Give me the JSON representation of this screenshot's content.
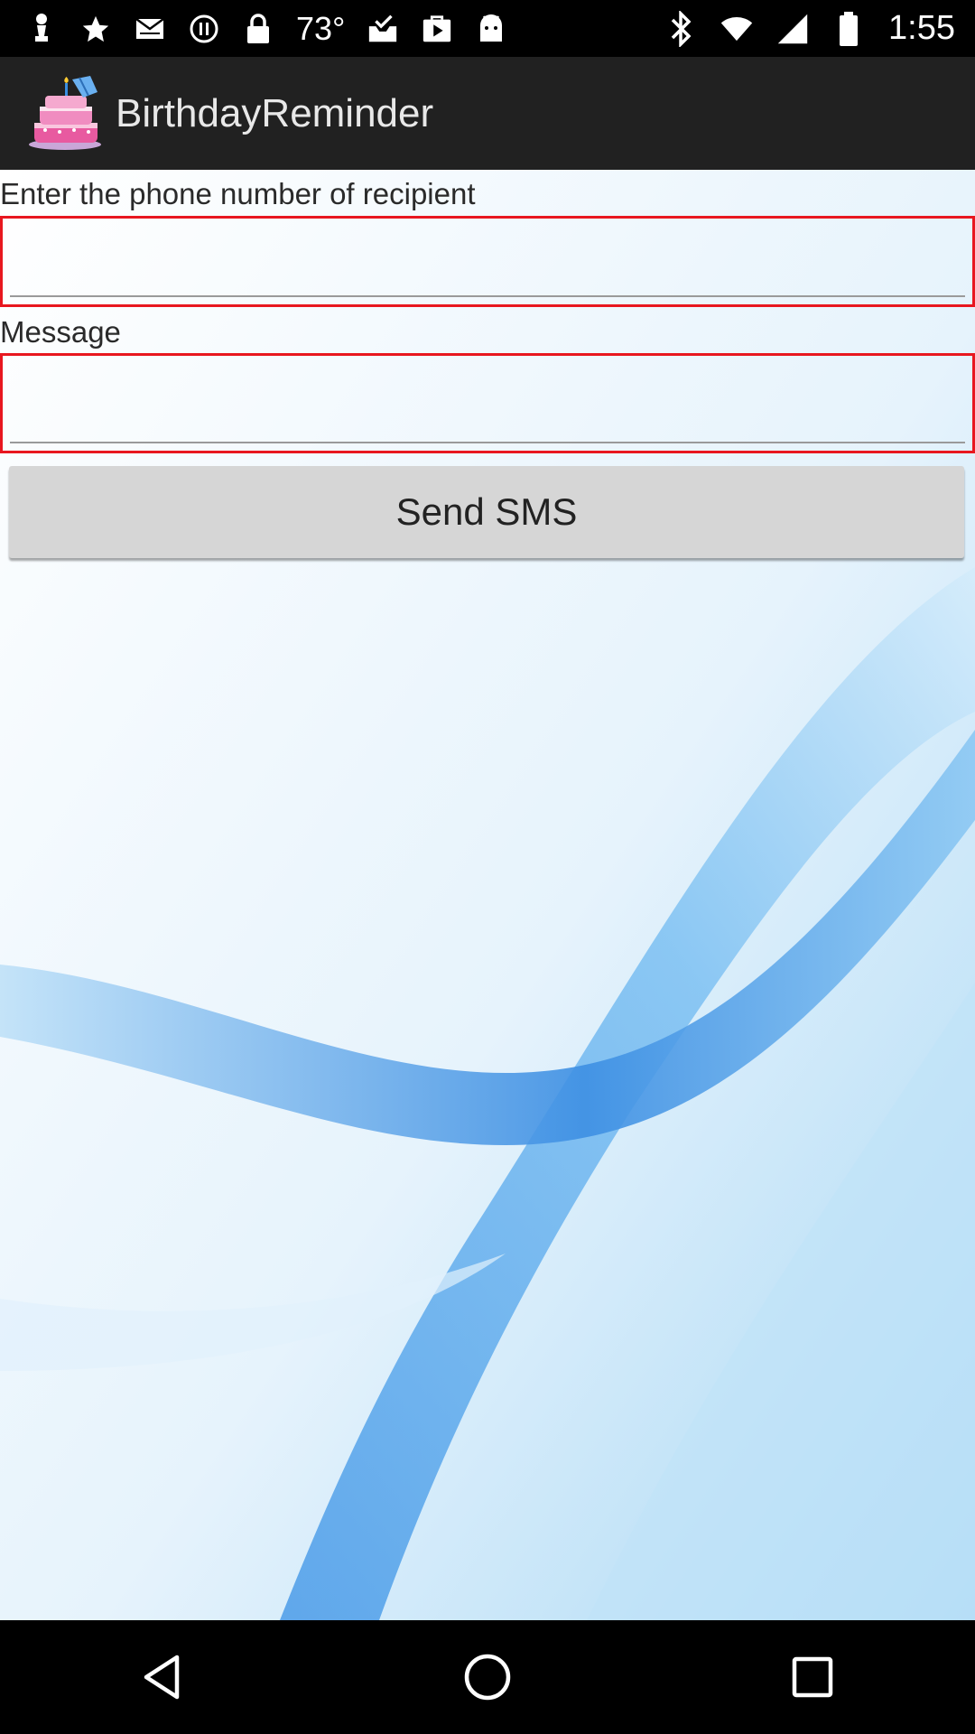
{
  "status_bar": {
    "temperature": "73°",
    "time": "1:55",
    "left_icons": [
      "chess-pawn-icon",
      "star-icon",
      "mail-icon",
      "pause-circle-icon",
      "lock-icon",
      "temperature-text",
      "download-tray-icon",
      "play-store-icon",
      "android-icon"
    ],
    "right_icons": [
      "bluetooth-icon",
      "wifi-icon",
      "signal-icon",
      "battery-icon"
    ]
  },
  "app_bar": {
    "title": "BirthdayReminder",
    "logo_icon": "birthday-cake-icon"
  },
  "form": {
    "phone_label": "Enter the phone number of recipient",
    "phone_value": "",
    "message_label": "Message",
    "message_value": "",
    "send_button_label": "Send SMS"
  },
  "colors": {
    "app_bar_bg": "#212121",
    "field_border": "#e8171f",
    "button_bg": "#d6d6d6",
    "swoosh_blue": "#4a9be8"
  },
  "nav_bar": {
    "icons": [
      "back-icon",
      "home-icon",
      "recents-icon"
    ]
  }
}
